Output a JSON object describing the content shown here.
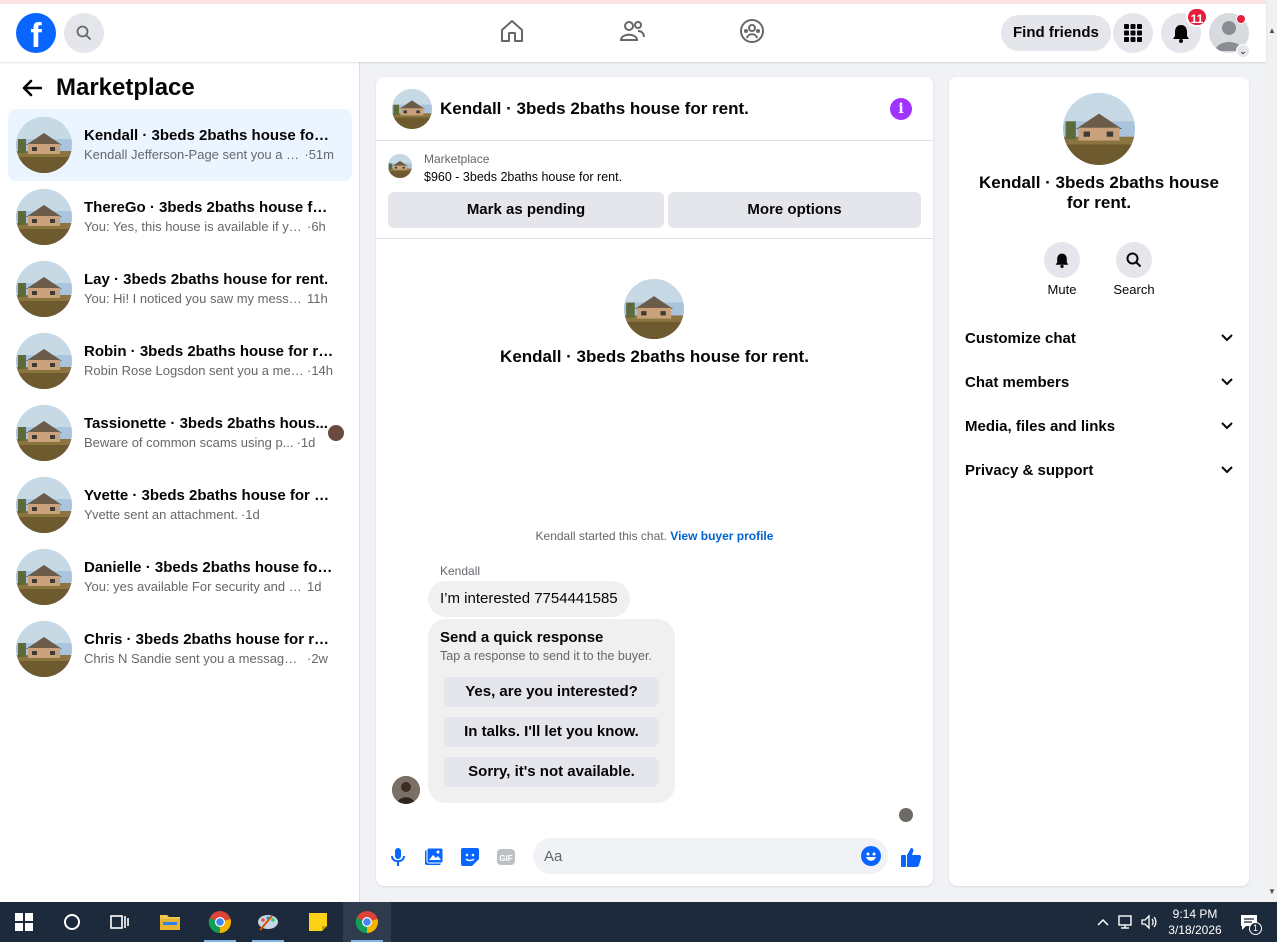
{
  "topbar": {
    "find_friends": "Find friends",
    "notification_count": "11"
  },
  "sidebar": {
    "title": "Marketplace",
    "conversations": [
      {
        "name": "Kendall · 3beds 2baths house for r...",
        "message": "Kendall Jefferson-Page sent you a m...",
        "time": "·51m",
        "active": true
      },
      {
        "name": "ThereGo · 3beds 2baths house for ...",
        "message": "You: Yes, this house is available if you ...",
        "time": "·6h"
      },
      {
        "name": "Lay · 3beds 2baths house for rent.",
        "message": "You: Hi! I noticed you saw my messa...",
        "time": "11h"
      },
      {
        "name": "Robin · 3beds 2baths house for rent.",
        "message": "Robin Rose Logsdon sent you a mes...",
        "time": "·14h"
      },
      {
        "name": "Tassionette · 3beds 2baths hous...",
        "message": "Beware of common scams using p...",
        "time": "·1d"
      },
      {
        "name": "Yvette · 3beds 2baths house for re...",
        "message": "Yvette sent an attachment.",
        "time": "·1d"
      },
      {
        "name": "Danielle · 3beds 2baths house for ...",
        "message": "You: yes available For security and veri...",
        "time": "1d"
      },
      {
        "name": "Chris · 3beds 2baths house for rent.",
        "message": "Chris N Sandie sent you a message a...",
        "time": "·2w"
      }
    ]
  },
  "chat": {
    "title": "Kendall · 3beds 2baths house for rent.",
    "listing_label": "Marketplace",
    "listing_price": "$960 - 3beds 2baths house for rent.",
    "mark_pending": "Mark as pending",
    "more_options": "More options",
    "center_title": "Kendall · 3beds 2baths house for rent.",
    "started_text": "Kendall started this chat.",
    "view_profile": "View buyer profile",
    "sender": "Kendall",
    "message": "I’m interested 7754441585",
    "quick_title": "Send a quick response",
    "quick_sub": "Tap a response to send it to the buyer.",
    "quick_responses": [
      "Yes, are you interested?",
      "In talks. I'll let you know.",
      "Sorry, it's not available."
    ],
    "input_placeholder": "Aa"
  },
  "rpanel": {
    "title": "Kendall · 3beds 2baths house for rent.",
    "mute": "Mute",
    "search": "Search",
    "sections": [
      "Customize chat",
      "Chat members",
      "Media, files and links",
      "Privacy & support"
    ]
  },
  "taskbar": {
    "time": "9:14 PM",
    "date": "3/18/2026",
    "action_center_count": "1"
  },
  "colors": {
    "brand": "#0866ff",
    "active_row": "#ebf5ff",
    "info_purple": "#a033ff",
    "badge_red": "#e41e3f"
  }
}
